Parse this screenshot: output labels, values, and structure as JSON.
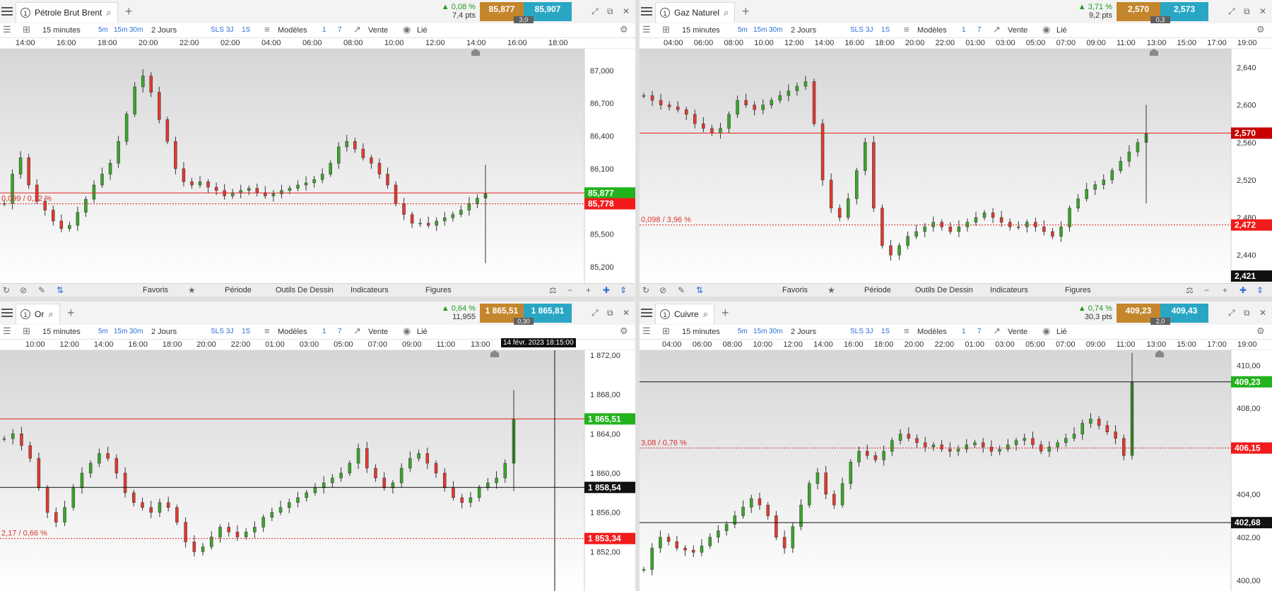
{
  "panels": [
    {
      "id": "brent",
      "instrument": "Pétrole Brut Brent",
      "tab_number": "1",
      "change_pct": "▲ 0,08 %",
      "change_pts": "7,4 pts",
      "bid": "85,877",
      "ask": "85,907",
      "spread": "3,0",
      "timeframe": "15 minutes",
      "period_buttons": [
        "5m",
        "15m",
        "30m"
      ],
      "range": "2 Jours",
      "period_buttons2": [
        "SLS",
        "3J",
        "1S"
      ],
      "models_label": "Modèles",
      "models_buttons": [
        "1",
        "7"
      ],
      "sale_label": "Vente",
      "linked_label": "Lié",
      "time_labels": [
        "14:00",
        "16:00",
        "18:00",
        "20:00",
        "22:00",
        "02:00",
        "04:00",
        "06:00",
        "08:00",
        "10:00",
        "12:00",
        "14:00",
        "16:00",
        "18:00"
      ],
      "price_labels": [
        "87,000",
        "86,700",
        "86,400",
        "86,100",
        "85,500",
        "85,200"
      ],
      "current_price_label": "85,877",
      "ref_price_label": "85,778",
      "ref_change_label": "0,099 / 0,12 %",
      "bottom_labels": [
        "Favoris",
        "Période",
        "Outils De Dessin",
        "Indicateurs",
        "Figures"
      ],
      "chart_data": {
        "type": "candlestick",
        "ylim": [
          85.05,
          87.2
        ],
        "current_price": 85.877,
        "reference_price": 85.778,
        "series": [
          85.78,
          86.05,
          86.2,
          85.95,
          85.8,
          85.72,
          85.62,
          85.55,
          85.58,
          85.7,
          85.82,
          85.95,
          86.05,
          86.15,
          86.35,
          86.6,
          86.85,
          86.95,
          86.8,
          86.55,
          86.35,
          86.1,
          85.98,
          85.95,
          85.98,
          85.93,
          85.9,
          85.85,
          85.88,
          85.9,
          85.92,
          85.88,
          85.85,
          85.87,
          85.9,
          85.92,
          85.95,
          85.97,
          86.0,
          86.05,
          86.15,
          86.3,
          86.35,
          86.28,
          86.2,
          86.15,
          86.05,
          85.95,
          85.78,
          85.68,
          85.6,
          85.6,
          85.58,
          85.62,
          85.65,
          85.68,
          85.72,
          85.78,
          85.83,
          85.87
        ]
      }
    },
    {
      "id": "gas",
      "instrument": "Gaz Naturel",
      "tab_number": "1",
      "change_pct": "▲ 3,71 %",
      "change_pts": "9,2 pts",
      "bid": "2,570",
      "ask": "2,573",
      "spread": "0,3",
      "timeframe": "15 minutes",
      "period_buttons": [
        "5m",
        "15m",
        "30m"
      ],
      "range": "2 Jours",
      "period_buttons2": [
        "SLS",
        "3J",
        "1S"
      ],
      "models_label": "Modèles",
      "models_buttons": [
        "1",
        "7"
      ],
      "sale_label": "Vente",
      "linked_label": "Lié",
      "time_labels": [
        "04:00",
        "06:00",
        "08:00",
        "10:00",
        "12:00",
        "14:00",
        "16:00",
        "18:00",
        "20:00",
        "22:00",
        "01:00",
        "03:00",
        "05:00",
        "07:00",
        "09:00",
        "11:00",
        "13:00",
        "15:00",
        "17:00",
        "19:00"
      ],
      "price_labels": [
        "2,640",
        "2,600",
        "2,560",
        "2,520",
        "2,480",
        "2,440"
      ],
      "current_price_label": "2,570",
      "ref_price_label": "2,472",
      "low_price_label": "2,421",
      "ref_change_label": "0,098 / 3,96 %",
      "bottom_labels": [
        "Favoris",
        "Période",
        "Outils De Dessin",
        "Indicateurs",
        "Figures"
      ],
      "chart_data": {
        "type": "candlestick",
        "ylim": [
          2.41,
          2.66
        ],
        "current_price": 2.57,
        "reference_price": 2.472,
        "series": [
          2.61,
          2.605,
          2.6,
          2.598,
          2.595,
          2.59,
          2.58,
          2.575,
          2.57,
          2.575,
          2.59,
          2.605,
          2.6,
          2.595,
          2.6,
          2.605,
          2.61,
          2.615,
          2.62,
          2.625,
          2.58,
          2.52,
          2.49,
          2.48,
          2.5,
          2.53,
          2.56,
          2.49,
          2.45,
          2.44,
          2.45,
          2.46,
          2.465,
          2.47,
          2.475,
          2.47,
          2.465,
          2.47,
          2.475,
          2.48,
          2.485,
          2.48,
          2.475,
          2.47,
          2.47,
          2.475,
          2.47,
          2.465,
          2.46,
          2.47,
          2.49,
          2.5,
          2.51,
          2.515,
          2.52,
          2.53,
          2.54,
          2.55,
          2.56,
          2.57
        ]
      }
    },
    {
      "id": "gold",
      "instrument": "Or",
      "tab_number": "1",
      "change_pct": "▲ 0,64 %",
      "change_pts": "11,955",
      "bid": "1 865,51",
      "ask": "1 865,81",
      "spread": "0,30",
      "timeframe": "15 minutes",
      "period_buttons": [
        "5m",
        "15m",
        "30m"
      ],
      "range": "2 Jours",
      "period_buttons2": [
        "SLS",
        "3J",
        "1S"
      ],
      "models_label": "Modèles",
      "models_buttons": [
        "1",
        "7"
      ],
      "sale_label": "Vente",
      "linked_label": "Lié",
      "time_labels": [
        "10:00",
        "12:00",
        "14:00",
        "16:00",
        "18:00",
        "20:00",
        "22:00",
        "01:00",
        "03:00",
        "05:00",
        "07:00",
        "09:00",
        "11:00",
        "13:00"
      ],
      "crosshair_time": "14 févr. 2023 18:15:00",
      "price_labels": [
        "1 872,00",
        "1 868,00",
        "1 864,00",
        "1 860,00",
        "1 856,00",
        "1 852,00"
      ],
      "current_price_label": "1 865,51",
      "crosshair_price_label": "1 858,54",
      "ref_price_label": "1 853,34",
      "ref_change_label": "2,17 / 0,66 %",
      "chart_data": {
        "type": "candlestick",
        "ylim": [
          1848.0,
          1872.5
        ],
        "current_price": 1865.51,
        "reference_price": 1853.34,
        "crosshair_price": 1858.54,
        "series": [
          1863.5,
          1864.0,
          1862.8,
          1861.5,
          1858.5,
          1856.0,
          1855.0,
          1856.5,
          1858.5,
          1860.0,
          1861.0,
          1862.0,
          1861.5,
          1860.0,
          1858.0,
          1857.0,
          1856.5,
          1856.0,
          1857.0,
          1856.5,
          1855.0,
          1853.0,
          1852.0,
          1852.5,
          1853.5,
          1854.5,
          1854.0,
          1853.5,
          1854.0,
          1854.5,
          1855.5,
          1856.0,
          1856.5,
          1857.0,
          1857.5,
          1858.0,
          1858.5,
          1859.0,
          1859.5,
          1860.0,
          1861.0,
          1862.5,
          1860.5,
          1859.5,
          1858.5,
          1859.0,
          1860.5,
          1861.5,
          1862.0,
          1861.0,
          1860.0,
          1858.5,
          1857.5,
          1857.0,
          1857.5,
          1858.5,
          1859.0,
          1859.5,
          1861.0,
          1865.5
        ]
      }
    },
    {
      "id": "copper",
      "instrument": "Cuivre",
      "tab_number": "1",
      "change_pct": "▲ 0,74 %",
      "change_pts": "30,3 pts",
      "bid": "409,23",
      "ask": "409,43",
      "spread": "2,0",
      "timeframe": "15 minutes",
      "period_buttons": [
        "5m",
        "15m",
        "30m"
      ],
      "range": "2 Jours",
      "period_buttons2": [
        "SLS",
        "3J",
        "1S"
      ],
      "models_label": "Modèles",
      "models_buttons": [
        "1",
        "7"
      ],
      "sale_label": "Vente",
      "linked_label": "Lié",
      "time_labels": [
        "04:00",
        "06:00",
        "08:00",
        "10:00",
        "12:00",
        "14:00",
        "16:00",
        "18:00",
        "20:00",
        "22:00",
        "01:00",
        "03:00",
        "05:00",
        "07:00",
        "09:00",
        "11:00",
        "13:00",
        "15:00",
        "17:00",
        "19:00"
      ],
      "price_labels": [
        "410,00",
        "408,00",
        "404,00",
        "402,00",
        "400,00"
      ],
      "current_price_label": "409,23",
      "ref_price_label": "406,15",
      "crosshair_price_label": "402,68",
      "ref_change_label": "3,08 / 0,76 %",
      "chart_data": {
        "type": "candlestick",
        "ylim": [
          399.5,
          410.7
        ],
        "current_price": 409.23,
        "reference_price": 406.15,
        "crosshair_price": 402.68,
        "series": [
          400.5,
          401.5,
          402.0,
          401.8,
          401.5,
          401.4,
          401.3,
          401.6,
          402.0,
          402.3,
          402.6,
          403.0,
          403.4,
          403.8,
          403.5,
          403.0,
          402.0,
          401.5,
          402.5,
          403.5,
          404.5,
          405.0,
          404.0,
          403.5,
          404.5,
          405.5,
          406.0,
          405.8,
          405.6,
          406.0,
          406.5,
          406.8,
          406.6,
          406.4,
          406.2,
          406.3,
          406.1,
          406.0,
          406.1,
          406.3,
          406.4,
          406.2,
          406.0,
          406.1,
          406.3,
          406.5,
          406.6,
          406.3,
          406.0,
          406.2,
          406.4,
          406.6,
          406.8,
          407.3,
          407.5,
          407.2,
          406.9,
          406.6,
          405.8,
          409.2
        ]
      }
    }
  ],
  "panels_bottom_bar_extra": {}
}
